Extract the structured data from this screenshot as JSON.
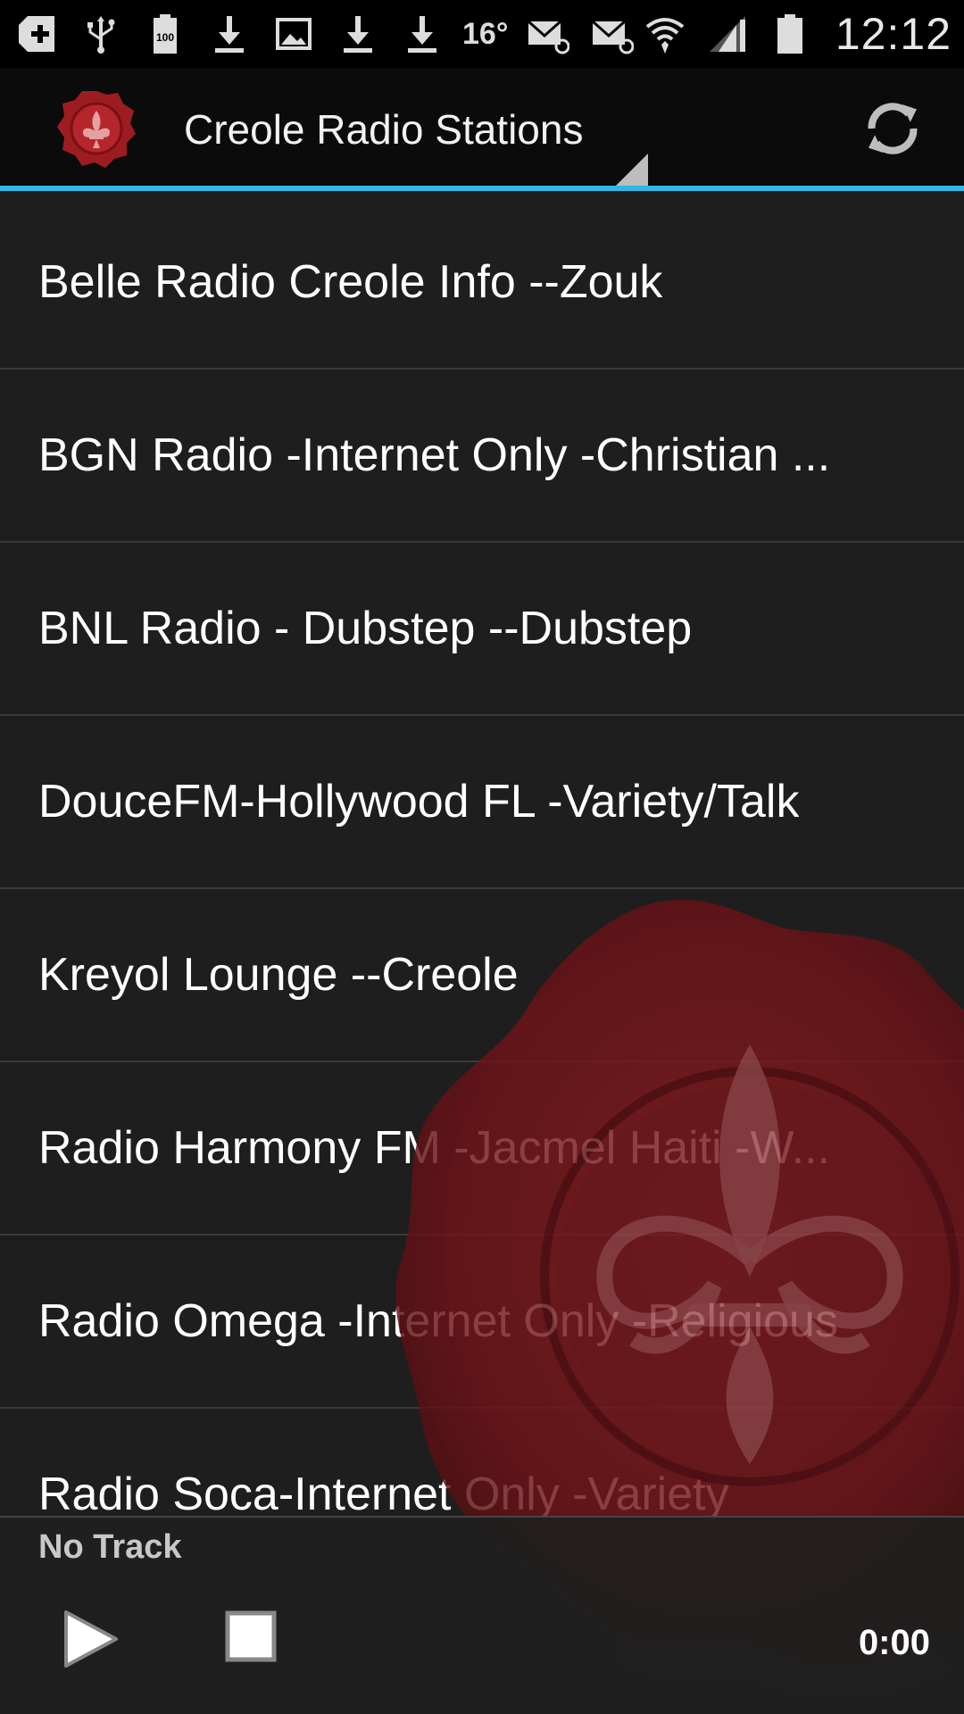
{
  "status_bar": {
    "icons": [
      "add-icon",
      "usb-icon",
      "battery-100-icon",
      "download-icon",
      "image-icon",
      "download-icon",
      "download-icon"
    ],
    "temperature": "16°",
    "clock": "12:12",
    "battery_level": "100"
  },
  "action_bar": {
    "title": "Creole Radio Stations",
    "accent_color": "#33b5e5"
  },
  "stations": [
    {
      "label": "Belle Radio Creole Info --Zouk"
    },
    {
      "label": "BGN Radio -Internet Only -Christian ..."
    },
    {
      "label": "BNL Radio - Dubstep  --Dubstep"
    },
    {
      "label": "DouceFM-Hollywood FL -Variety/Talk"
    },
    {
      "label": "Kreyol Lounge --Creole"
    },
    {
      "label": "Radio Harmony FM -Jacmel Haiti -W..."
    },
    {
      "label": "Radio Omega -Internet Only -Religious"
    },
    {
      "label": "Radio Soca-Internet Only -Variety"
    }
  ],
  "player": {
    "track": "No Track",
    "elapsed": "0:00"
  }
}
